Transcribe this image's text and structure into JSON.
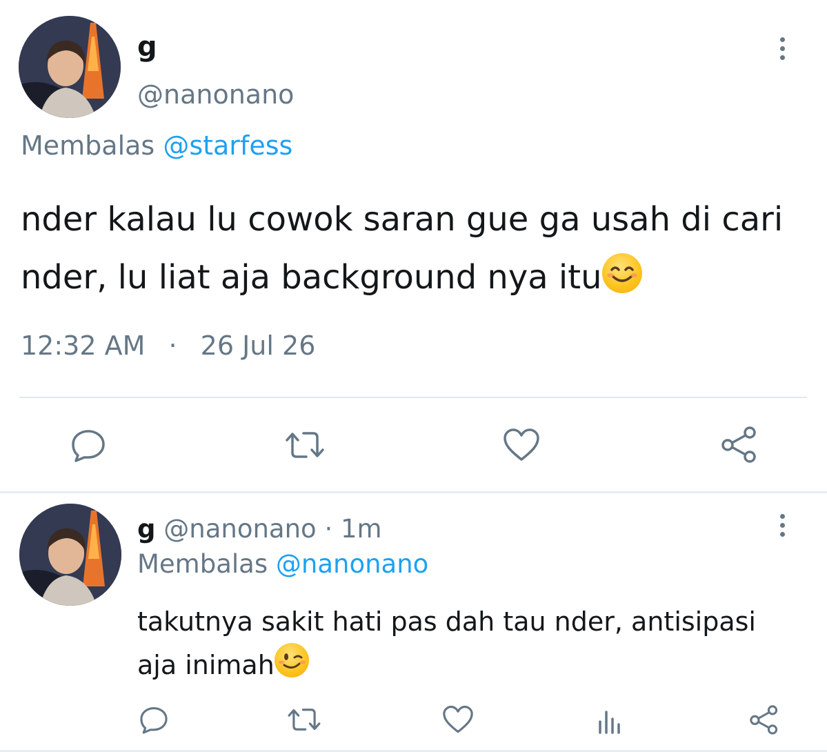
{
  "tweet": {
    "display_name": "g",
    "handle": "@nanonano",
    "reply_prefix": "Membalas",
    "reply_to": "@starfess",
    "text": "nder kalau lu cowok saran gue ga usah di cari nder, lu liat aja background nya itu",
    "emoji": "smiling-face-with-smiling-eyes",
    "time": "12:32 AM",
    "separator": "·",
    "date": "26 Jul 26"
  },
  "reply": {
    "display_name": "g",
    "handle": "@nanonano",
    "separator": "·",
    "age": "1m",
    "reply_prefix": "Membalas",
    "reply_to": "@nanonano",
    "text_line1": "takutnya sakit hati pas dah tau nder, antisipasi",
    "text_line2": "aja inimah",
    "emoji": "winking-face"
  },
  "colors": {
    "muted": "#657786",
    "link": "#1da1f2",
    "divider": "#e1e8ed"
  }
}
